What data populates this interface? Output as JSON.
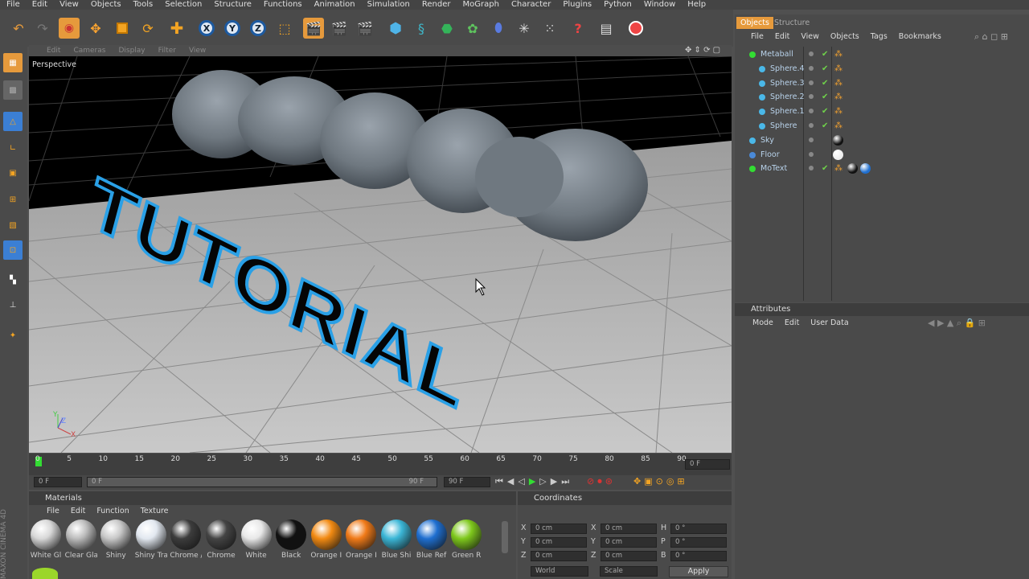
{
  "menu": [
    "File",
    "Edit",
    "View",
    "Objects",
    "Tools",
    "Selection",
    "Structure",
    "Functions",
    "Animation",
    "Simulation",
    "Render",
    "MoGraph",
    "Character",
    "Plugins",
    "Python",
    "Window",
    "Help"
  ],
  "axis_buttons": [
    "X",
    "Y",
    "Z"
  ],
  "viewport": {
    "menu": [
      "Edit",
      "Cameras",
      "Display",
      "Filter",
      "View"
    ],
    "label": "Perspective",
    "text": "TUTORIAL",
    "axes": [
      "Y",
      "Z",
      "X"
    ]
  },
  "timeline": {
    "ticks": [
      "0",
      "5",
      "10",
      "15",
      "20",
      "25",
      "30",
      "35",
      "40",
      "45",
      "50",
      "55",
      "60",
      "65",
      "70",
      "75",
      "80",
      "85",
      "90"
    ],
    "current": "0 F",
    "start": "0 F",
    "range_start": "0 F",
    "range_end": "90 F",
    "end": "90 F"
  },
  "materials": {
    "title": "Materials",
    "menu": [
      "File",
      "Edit",
      "Function",
      "Texture"
    ],
    "items": [
      {
        "label": "White Gl",
        "color": "#d8d8d8"
      },
      {
        "label": "Clear Gla",
        "color": "#bcbcbc"
      },
      {
        "label": "Shiny",
        "color": "#c8c8c8"
      },
      {
        "label": "Shiny Tra",
        "color": "#e2e8f0"
      },
      {
        "label": "Chrome /",
        "color": "#3c3c3c"
      },
      {
        "label": "Chrome",
        "color": "#444"
      },
      {
        "label": "White",
        "color": "#e8e8e8"
      },
      {
        "label": "Black",
        "color": "#111"
      },
      {
        "label": "Orange I",
        "color": "#f28a12"
      },
      {
        "label": "Orange I",
        "color": "#f07a18"
      },
      {
        "label": "Blue Shi",
        "color": "#3bb6d6"
      },
      {
        "label": "Blue Ref",
        "color": "#1f6fd0"
      },
      {
        "label": "Green R",
        "color": "#7ec81c"
      }
    ]
  },
  "coordinates": {
    "title": "Coordinates",
    "rows": [
      {
        "a": "X",
        "av": "0 cm",
        "b": "X",
        "bv": "0 cm",
        "c": "H",
        "cv": "0 °"
      },
      {
        "a": "Y",
        "av": "0 cm",
        "b": "Y",
        "bv": "0 cm",
        "c": "P",
        "cv": "0 °"
      },
      {
        "a": "Z",
        "av": "0 cm",
        "b": "Z",
        "bv": "0 cm",
        "c": "B",
        "cv": "0 °"
      }
    ],
    "mode": "World",
    "scale": "Scale",
    "apply": "Apply"
  },
  "objects": {
    "tabs": [
      "Objects",
      "Structure"
    ],
    "menu": [
      "File",
      "Edit",
      "View",
      "Objects",
      "Tags",
      "Bookmarks"
    ],
    "items": [
      "Metaball",
      "Sphere.4",
      "Sphere.3",
      "Sphere.2",
      "Sphere.1",
      "Sphere",
      "Sky",
      "Floor",
      "MoText"
    ]
  },
  "attributes": {
    "title": "Attributes",
    "menu": [
      "Mode",
      "Edit",
      "User Data"
    ]
  },
  "brand": "MAXON CINEMA 4D",
  "colors": {
    "accent": "#e69a3c",
    "highlight_blue": "#2aa0e6"
  }
}
